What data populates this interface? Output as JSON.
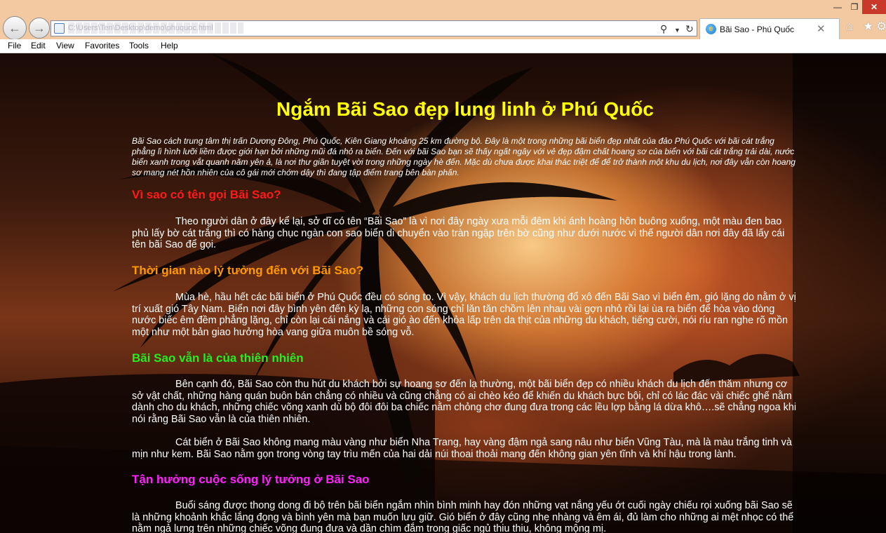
{
  "browser": {
    "url": "C:\\Users\\Ten\\Desktop\\demo\\phuquoc.html",
    "tab_title": "Bãi Sao - Phú Quốc",
    "menu": [
      "File",
      "Edit",
      "View",
      "Favorites",
      "Tools",
      "Help"
    ]
  },
  "page": {
    "title": "Ngắm Bãi Sao đẹp lung linh ở Phú Quốc",
    "intro": "Bãi Sao cách trung tâm thị trấn Dương Đông, Phú Quốc, Kiên Giang khoảng 25 km đường bộ. Đây là một trong những bãi biển đẹp nhất của đảo Phú Quốc với bãi cát trắng phẳng lì hình lưỡi liềm được giới hạn bởi những mũi đá nhỏ ra biển. Đến với bãi Sao bạn sẽ thấy ngất ngây với vẻ đẹp đậm chất hoang sơ của biển với bãi cát trắng trải dài, nước biển xanh trong vắt quanh năm yên ả, là nơi thư giãn tuyệt vời trong những ngày hè đến. Mặc dù chưa được khai thác triệt để để trở thành một khu du lịch, nơi đây vẫn còn hoang sơ mang nét hồn nhiên của cô gái mới chớm dậy thì đang tập điểm trang bên bàn phấn.",
    "sections": [
      {
        "heading": "Vì sao có tên gọi Bãi Sao?",
        "color": "#ff1a1a",
        "paragraphs": [
          "Theo người dân ở đây kể lại, sở dĩ có tên “Bãi Sao” là vì nơi đây ngày xưa mỗi đêm khi ánh hoàng hôn buông xuống, một màu đen bao phủ lấy bờ cát trắng thì có hàng chục ngàn con sao biển di chuyển vào tràn ngập trên bờ cũng như dưới nước vì thế người dân nơi đây đã lấy cái tên bãi Sao để gọi."
        ]
      },
      {
        "heading": "Thời gian nào lý tưởng đến với Bãi Sao?",
        "color": "#ff9900",
        "paragraphs": [
          "Mùa hè, hầu hết các bãi biển ở Phú Quốc đều có sóng to. Vì vậy, khách du lịch thường đổ xô đến Bãi Sao vì biển êm, gió lặng do nằm ở vị trí xuất gió Tây Nam. Biển nơi đây bình yên đến kỳ lạ, những con sóng chỉ lăn tăn chồm lên nhau vài gợn nhỏ rồi lại ùa ra biển để hòa vào dòng nước biếc êm đềm phẳng lặng, chỉ còn lại cái nắng và cái gió ào đến khỏa lấp trên da thịt của những du khách, tiếng cười, nói ríu ran nghe rõ mồn một như một bản giao hưởng hòa vang giữa muôn bề sóng vỗ."
        ]
      },
      {
        "heading": "Bãi Sao vẫn là của thiên nhiên",
        "color": "#22ee22",
        "paragraphs": [
          "Bên cạnh đó, Bãi Sao còn thu hút du khách bởi sự hoang sơ đến lạ thường, một bãi biển đẹp có nhiều khách du lịch đến thăm nhưng cơ sở vật chất, những hàng quán buôn bán chẳng có nhiều và cũng chẳng có ai chèo kéo để khiến du khách bực bội, chỉ có lác đác vài chiếc ghế nằm dành cho du khách, những chiếc võng xanh dù bộ đôi đôi ba chiếc nằm chỏng chơ đung đưa trong các lều lợp bằng lá dừa khô….sẽ chẳng ngoa khi nói rằng Bãi Sao vẫn là của thiên nhiên.",
          "Cát biển ở Bãi Sao không mang màu vàng như biển Nha Trang, hay vàng đậm ngả sang nâu như biển Vũng Tàu, mà là màu trắng tinh và mịn như kem. Bãi Sao nằm gọn trong vòng tay trìu mến của hai dải núi thoai thoải mang đến không gian yên tĩnh và khí hậu trong lành."
        ]
      },
      {
        "heading": "Tận hưởng cuộc sống lý tưởng ở Bãi Sao",
        "color": "#ff22ff",
        "paragraphs": [
          "Buổi sáng được thong dong đi bộ trên bãi biển ngắm nhìn bình minh hay đón những vạt nắng yếu ớt cuối ngày chiếu rọi xuống bãi Sao sẽ là những khoảnh khắc lắng đọng và bình yên mà bạn muốn lưu giữ. Gió biển ở đây cũng nhẹ nhàng và êm ái, đủ làm cho những ai mệt nhọc có thể nằm ngả lưng trên những chiếc võng đung đưa và dần chìm đắm trong giấc ngủ thiu thiu, không mộng mị."
        ]
      }
    ]
  },
  "icons": {
    "back": "back-arrow-icon",
    "forward": "forward-arrow-icon",
    "search": "search-icon",
    "refresh": "refresh-icon",
    "home": "home-icon",
    "favorites": "star-icon",
    "settings": "gear-icon"
  },
  "colors": {
    "title": "#ffff00",
    "chrome": "#f2c9a1",
    "close": "#c9392a"
  }
}
